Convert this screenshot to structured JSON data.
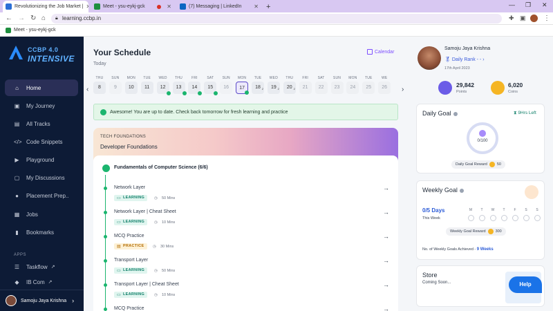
{
  "browser": {
    "tabs": [
      {
        "title": "Revolutionizing the Job Market |",
        "active": true
      },
      {
        "title": "Meet - ysu-eykj-gck",
        "active": false
      },
      {
        "title": "(7) Messaging | LinkedIn",
        "active": false
      }
    ],
    "url": "learning.ccbp.in",
    "bookmark": "Meet - ysu-eykj-gck"
  },
  "sidebar": {
    "logo_line1": "CCBP 4.0",
    "logo_line2": "INTENSIVE",
    "items": [
      {
        "label": "Home",
        "icon": "home-icon"
      },
      {
        "label": "My Journey",
        "icon": "journey-icon"
      },
      {
        "label": "All Tracks",
        "icon": "tracks-icon"
      },
      {
        "label": "Code Snippets",
        "icon": "code-icon"
      },
      {
        "label": "Playground",
        "icon": "playground-icon"
      },
      {
        "label": "My Discussions",
        "icon": "discussion-icon"
      },
      {
        "label": "Placement Prep..",
        "icon": "placement-icon"
      },
      {
        "label": "Jobs",
        "icon": "jobs-icon"
      },
      {
        "label": "Bookmarks",
        "icon": "bookmark-icon"
      }
    ],
    "apps_label": "APPS",
    "apps": [
      {
        "label": "Taskflow"
      },
      {
        "label": "IB Com"
      }
    ],
    "user_name": "Samoju Jaya Krishna"
  },
  "schedule": {
    "title": "Your Schedule",
    "subtitle": "Today",
    "calendar_label": "Calendar",
    "days": [
      {
        "name": "THU",
        "date": "8",
        "done": false
      },
      {
        "name": "SUN",
        "date": "9",
        "done": false,
        "weekend": true
      },
      {
        "name": "MON",
        "date": "10",
        "done": false
      },
      {
        "name": "TUE",
        "date": "11",
        "done": false
      },
      {
        "name": "WED",
        "date": "12",
        "done": true
      },
      {
        "name": "THU",
        "date": "13",
        "done": true
      },
      {
        "name": "FRI",
        "date": "14",
        "done": true
      },
      {
        "name": "SAT",
        "date": "15",
        "done": true
      },
      {
        "name": "SUN",
        "date": "16",
        "done": false,
        "weekend": true
      },
      {
        "name": "MON",
        "date": "17",
        "done": true,
        "today": true
      },
      {
        "name": "TUE",
        "date": "18",
        "sub": "2"
      },
      {
        "name": "WED",
        "date": "19",
        "sub": "2"
      },
      {
        "name": "THU",
        "date": "20",
        "sub": "2"
      },
      {
        "name": "FRI",
        "date": "21",
        "future": true
      },
      {
        "name": "SAT",
        "date": "22",
        "future": true
      },
      {
        "name": "SUN",
        "date": "23",
        "future": true
      },
      {
        "name": "MON",
        "date": "24",
        "future": true
      },
      {
        "name": "TUE",
        "date": "25",
        "future": true
      },
      {
        "name": "WE",
        "date": "26",
        "future": true
      }
    ],
    "banner": "Awesome! You are up to date. Check back tomorrow for fresh learning and practice"
  },
  "track": {
    "category": "TECH FOUNDATIONS",
    "name": "Developer Foundations",
    "module_title": "Fundamentals of Computer Science (6/6)",
    "items": [
      {
        "title": "Network Layer",
        "badge": "LEARNING",
        "type": "learn",
        "time": "50 Mins"
      },
      {
        "title": "Network Layer | Cheat Sheet",
        "badge": "LEARNING",
        "type": "learn",
        "time": "10 Mins"
      },
      {
        "title": "MCQ Practice",
        "badge": "PRACTICE",
        "type": "prac",
        "time": "30 Mins"
      },
      {
        "title": "Transport Layer",
        "badge": "LEARNING",
        "type": "learn",
        "time": "50 Mins"
      },
      {
        "title": "Transport Layer | Cheat Sheet",
        "badge": "LEARNING",
        "type": "learn",
        "time": "10 Mins"
      },
      {
        "title": "MCQ Practice",
        "badge": "",
        "type": "",
        "time": ""
      }
    ]
  },
  "profile": {
    "name": "Samoju Jaya Krishna",
    "rank_label": "Daily Rank - -",
    "date": "17th April 2023",
    "points_value": "29,842",
    "points_label": "Points",
    "coins_value": "6,020",
    "coins_label": "Coins"
  },
  "daily_goal": {
    "title": "Daily Goal",
    "hours_left": "9Hrs Left",
    "progress": "0/100",
    "reward_label": "Daily Goal Reward",
    "reward_value": "50"
  },
  "weekly_goal": {
    "title": "Weekly Goal",
    "days_label": "0/5 Days",
    "this_week": "This Week",
    "weekdays": [
      "M",
      "T",
      "W",
      "T",
      "F",
      "S",
      "S"
    ],
    "reward_label": "Weekly Goal Reward",
    "reward_value": "300",
    "achieved_label": "No. of Weekly Goals Achieved -",
    "achieved_value": "9 Weeks"
  },
  "store": {
    "title": "Store",
    "subtitle": "Coming Soon..."
  },
  "help_label": "Help",
  "colors": {
    "sidebar_bg": "#0d1b36",
    "accent_purple": "#5b49c9",
    "success_green": "#1bb56e",
    "link_blue": "#3b5bdb"
  }
}
